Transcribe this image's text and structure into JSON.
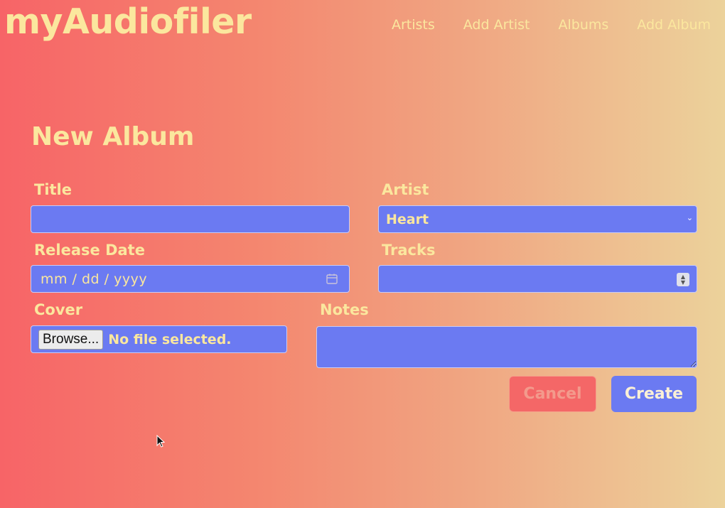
{
  "app": {
    "brand": "myAudiofiler"
  },
  "nav": {
    "items": [
      "Artists",
      "Add Artist",
      "Albums",
      "Add Album"
    ]
  },
  "form": {
    "heading": "New Album",
    "title_label": "Title",
    "title_value": "",
    "artist_label": "Artist",
    "artist_selected": "Heart",
    "release_label": "Release Date",
    "release_placeholder": "mm / dd / yyyy",
    "tracks_label": "Tracks",
    "tracks_value": "",
    "cover_label": "Cover",
    "browse_label": "Browse...",
    "file_status": "No file selected.",
    "notes_label": "Notes",
    "notes_value": "",
    "cancel_label": "Cancel",
    "create_label": "Create"
  },
  "colors": {
    "accent_text": "#fbe79e",
    "field_bg": "#6b7af2",
    "cancel_bg": "#f46767"
  }
}
